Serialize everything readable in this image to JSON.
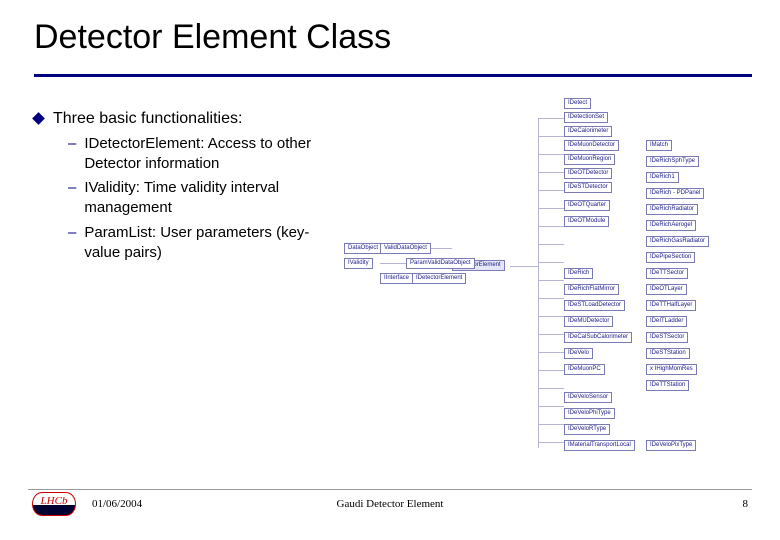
{
  "title": "Detector Element Class",
  "bullet": {
    "text": "Three basic functionalities:"
  },
  "sub": [
    {
      "text": "IDetectorElement: Access to other Detector information"
    },
    {
      "text": "IValidity: Time validity interval management"
    },
    {
      "text": "ParamList: User parameters (key-value pairs)"
    }
  ],
  "diagram": {
    "focus": "DetectorElement",
    "parents": [
      "DataObject",
      "IValidity",
      "ValidDataObject",
      "ParamValidDataObject",
      "IInterface",
      "IDetectorElement"
    ],
    "top_chain": [
      "IDetect",
      "IDetectionSet",
      "IDeCalorimeter",
      "IDeMuonDetector",
      "IDeMuonRegion",
      "IDeOTDetector",
      "IDeSTDetector"
    ],
    "right_side": [
      "IMatch",
      "IDeRichSphType",
      "IDeRich1",
      "IDeRich - PDPanel",
      "IDeRichRadiator",
      "IDeRichAerogel",
      "IDeRichGasRadiator",
      "IDePipeSection",
      "IDeTTSector"
    ],
    "right_out": [
      "IDeOTQuarter",
      "IDeOTModule",
      "IDeRich",
      "IDeRichFlatMirror",
      "IDeSTLoadDetector",
      "IDeMUDetector",
      "IDeCalSubCalorimeter",
      "IDeVelo",
      "IDeMuonPC"
    ],
    "right_far": [
      "IDeOTLayer",
      "IDeTTHalfLayer",
      "IDeITLadder",
      "IDeSTSector",
      "IDeSTStation",
      "x IHighMomRes",
      "IDeTTStation"
    ],
    "bottom_chain": [
      "IDeVeloSensor",
      "IDeVeloPhiType",
      "IDeVeloRType",
      "IMaterialTransportLocal",
      "IDeVeloPixType"
    ]
  },
  "footer": {
    "logo_text": "LHCb",
    "date": "01/06/2004",
    "center": "Gaudi Detector Element",
    "page": "8"
  }
}
